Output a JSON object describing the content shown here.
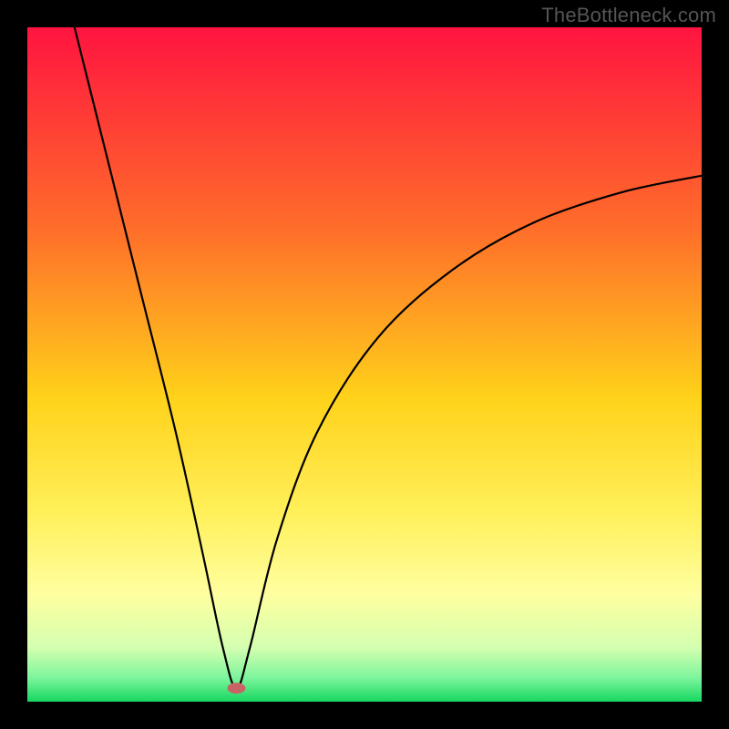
{
  "watermark": "TheBottleneck.com",
  "chart_data": {
    "type": "line",
    "title": "",
    "xlabel": "",
    "ylabel": "",
    "xlim": [
      0,
      100
    ],
    "ylim": [
      0,
      100
    ],
    "grid": false,
    "curve": {
      "name": "bottleneck-curve",
      "x_vertex": 31,
      "y_vertex": 2,
      "left_start": {
        "x": 7,
        "y": 100
      },
      "right_end": {
        "x": 100,
        "y": 78
      },
      "points": [
        {
          "x": 7,
          "y": 100
        },
        {
          "x": 12,
          "y": 80
        },
        {
          "x": 17,
          "y": 60
        },
        {
          "x": 22,
          "y": 40
        },
        {
          "x": 26,
          "y": 22
        },
        {
          "x": 29,
          "y": 8
        },
        {
          "x": 31,
          "y": 2
        },
        {
          "x": 33,
          "y": 8
        },
        {
          "x": 37,
          "y": 24
        },
        {
          "x": 43,
          "y": 40
        },
        {
          "x": 52,
          "y": 54
        },
        {
          "x": 63,
          "y": 64
        },
        {
          "x": 75,
          "y": 71
        },
        {
          "x": 88,
          "y": 75.5
        },
        {
          "x": 100,
          "y": 78
        }
      ]
    },
    "marker": {
      "x": 31,
      "y": 2,
      "color": "#c86464",
      "rx": 10,
      "ry": 6
    },
    "gradient_stops": [
      {
        "t": 0.0,
        "color": "#ff1440"
      },
      {
        "t": 0.3,
        "color": "#ff6e2a"
      },
      {
        "t": 0.55,
        "color": "#ffd21a"
      },
      {
        "t": 0.72,
        "color": "#fff05a"
      },
      {
        "t": 0.84,
        "color": "#ffffa0"
      },
      {
        "t": 0.92,
        "color": "#d4ffb0"
      },
      {
        "t": 0.965,
        "color": "#7cf59c"
      },
      {
        "t": 1.0,
        "color": "#17d760"
      }
    ]
  }
}
